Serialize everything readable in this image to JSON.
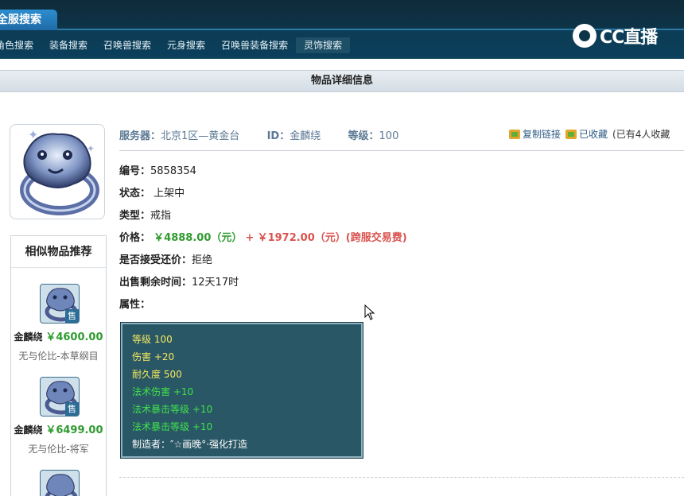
{
  "header": {
    "main_tab": "全服搜索",
    "logo_text": "CC直播",
    "nav": [
      "角色搜索",
      "装备搜索",
      "召唤兽搜索",
      "元身搜索",
      "召唤兽装备搜索",
      "灵饰搜索"
    ],
    "active_nav": "灵饰搜索"
  },
  "page": {
    "title": "物品详细信息"
  },
  "item": {
    "server_label": "服务器：",
    "server_value": "北京1区—黄金台",
    "id_label": "ID：",
    "id_value": "金麟绕",
    "level_label": "等级：",
    "level_value": "100",
    "copy_link": "复制链接",
    "favorited": "已收藏",
    "fav_count": "(已有4人收藏",
    "number_label": "编号：",
    "number_value": "5858354",
    "status_label": "状态：",
    "status_value": "上架中",
    "type_label": "类型：",
    "type_value": "戒指",
    "price_label": "价格：",
    "price_value": "￥4888.00（元）",
    "price_plus": "+",
    "fee_value": "￥1972.00（元）(跨服交易费)",
    "bargain_label": "是否接受还价：",
    "bargain_value": "拒绝",
    "remain_label": "出售剩余时间：",
    "remain_value": "12天17时",
    "attr_label": "属性："
  },
  "attributes": [
    {
      "text": "等级 100",
      "color": "#f3e95e"
    },
    {
      "text": "伤害 +20",
      "color": "#f3e95e"
    },
    {
      "text": "耐久度 500",
      "color": "#f3e95e"
    },
    {
      "text": "法术伤害 +10",
      "color": "#3ee34a"
    },
    {
      "text": "法术暴击等级 +10",
      "color": "#3ee34a"
    },
    {
      "text": "法术暴击等级 +10",
      "color": "#3ee34a"
    },
    {
      "text": "制造者：″☆画晚°·强化打造",
      "color": "#ffffff"
    }
  ],
  "similar": {
    "title": "相似物品推荐",
    "items": [
      {
        "name": "金麟绕",
        "price": "￥4600.00",
        "desc": "无与伦比-本草纲目",
        "badge": "售"
      },
      {
        "name": "金麟绕",
        "price": "￥6499.00",
        "desc": "无与伦比-将军",
        "badge": "售"
      }
    ]
  },
  "colors": {
    "header_bg": "#0d3448",
    "price_green": "#2f9b2f",
    "price_red": "#d9534f",
    "attr_box_bg": "#2a5766"
  }
}
